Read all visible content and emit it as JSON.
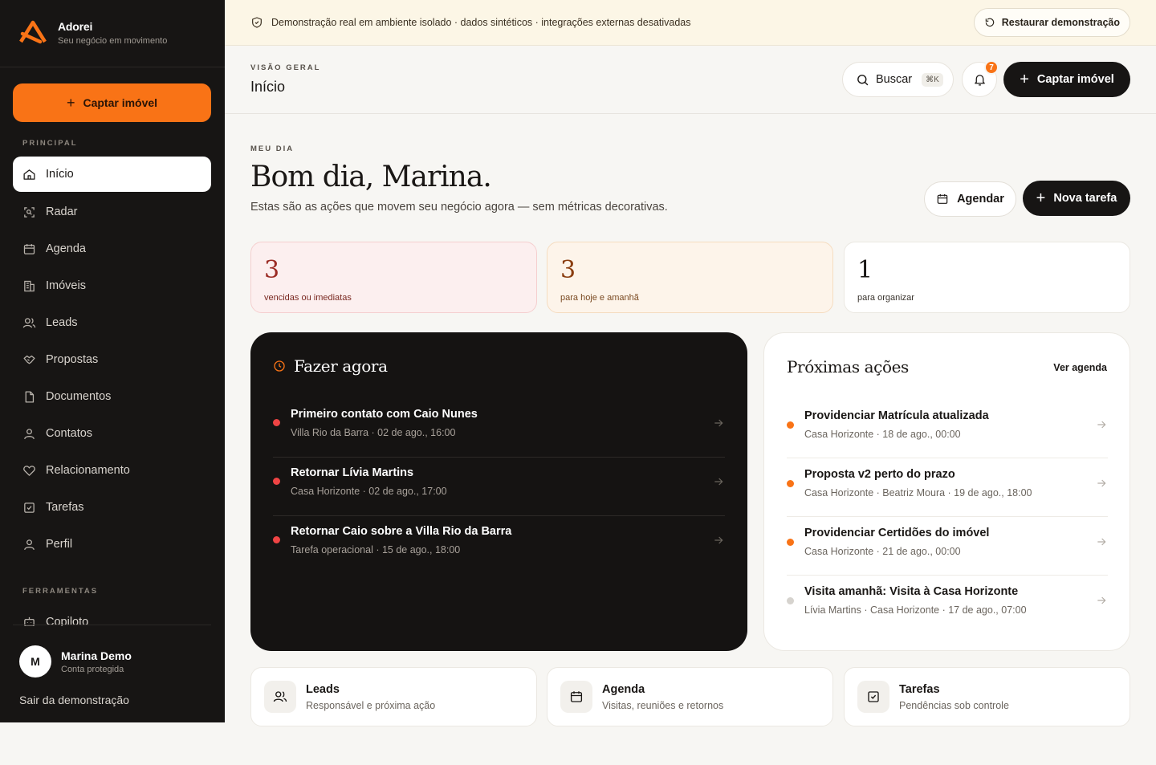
{
  "brand": {
    "name": "Adorei",
    "tagline": "Seu negócio em movimento"
  },
  "sidebar": {
    "cta_label": "Captar imóvel",
    "section_main": "PRINCIPAL",
    "items": [
      {
        "label": "Início",
        "icon": "home-icon",
        "active": true
      },
      {
        "label": "Radar",
        "icon": "radar-icon"
      },
      {
        "label": "Agenda",
        "icon": "calendar-icon"
      },
      {
        "label": "Imóveis",
        "icon": "building-icon"
      },
      {
        "label": "Leads",
        "icon": "users-icon"
      },
      {
        "label": "Propostas",
        "icon": "handshake-icon"
      },
      {
        "label": "Documentos",
        "icon": "document-icon"
      },
      {
        "label": "Contatos",
        "icon": "user-icon"
      },
      {
        "label": "Relacionamento",
        "icon": "heart-icon"
      },
      {
        "label": "Tarefas",
        "icon": "checkbox-icon"
      },
      {
        "label": "Perfil",
        "icon": "user-icon"
      }
    ],
    "section_tools": "FERRAMENTAS",
    "tools": [
      {
        "label": "Copiloto",
        "icon": "bot-icon"
      }
    ],
    "user": {
      "initial": "M",
      "name": "Marina Demo",
      "subtitle": "Conta protegida"
    },
    "logout": "Sair da demonstração"
  },
  "banner": {
    "text": "Demonstração real em ambiente isolado · dados sintéticos · integrações externas desativadas",
    "restore_label": "Restaurar demonstração"
  },
  "header": {
    "eyebrow": "VISÃO GERAL",
    "title": "Início",
    "search_label": "Buscar",
    "search_shortcut": "⌘K",
    "notifications_count": "7",
    "capture_label": "Captar imóvel"
  },
  "main": {
    "eyebrow": "MEU DIA",
    "greeting": "Bom dia, Marina.",
    "subtitle": "Estas são as ações que movem seu negócio agora — sem métricas decorativas.",
    "schedule_label": "Agendar",
    "new_task_label": "Nova tarefa",
    "stats": [
      {
        "value": "3",
        "label": "vencidas ou imediatas"
      },
      {
        "value": "3",
        "label": "para hoje e amanhã"
      },
      {
        "value": "1",
        "label": "para organizar"
      }
    ],
    "now": {
      "title": "Fazer agora",
      "items": [
        {
          "title": "Primeiro contato com Caio Nunes",
          "meta": "Villa Rio da Barra · 02 de ago., 16:00"
        },
        {
          "title": "Retornar Lívia Martins",
          "meta": "Casa Horizonte · 02 de ago., 17:00"
        },
        {
          "title": "Retornar Caio sobre a Villa Rio da Barra",
          "meta": "Tarefa operacional · 15 de ago., 18:00"
        }
      ]
    },
    "next": {
      "title": "Próximas ações",
      "link_label": "Ver agenda",
      "items": [
        {
          "title": "Providenciar Matrícula atualizada",
          "meta": "Casa Horizonte · 18 de ago., 00:00",
          "status_color": "#f97316"
        },
        {
          "title": "Proposta v2 perto do prazo",
          "meta": "Casa Horizonte · Beatriz Moura · 19 de ago., 18:00",
          "status_color": "#f97316"
        },
        {
          "title": "Providenciar Certidões do imóvel",
          "meta": "Casa Horizonte · 21 de ago., 00:00",
          "status_color": "#f97316"
        },
        {
          "title": "Visita amanhã: Visita à Casa Horizonte",
          "meta": "Lívia Martins · Casa Horizonte · 17 de ago., 07:00",
          "status_color": "#d6d3ce"
        }
      ]
    },
    "shortcuts": [
      {
        "title": "Leads",
        "subtitle": "Responsável e próxima ação",
        "icon": "users-icon"
      },
      {
        "title": "Agenda",
        "subtitle": "Visitas, reuniões e retornos",
        "icon": "calendar-icon"
      },
      {
        "title": "Tarefas",
        "subtitle": "Pendências sob controle",
        "icon": "checkbox-icon"
      }
    ]
  },
  "colors": {
    "accent": "#f97316",
    "dark": "#171514",
    "urgent": "#ef4444"
  }
}
